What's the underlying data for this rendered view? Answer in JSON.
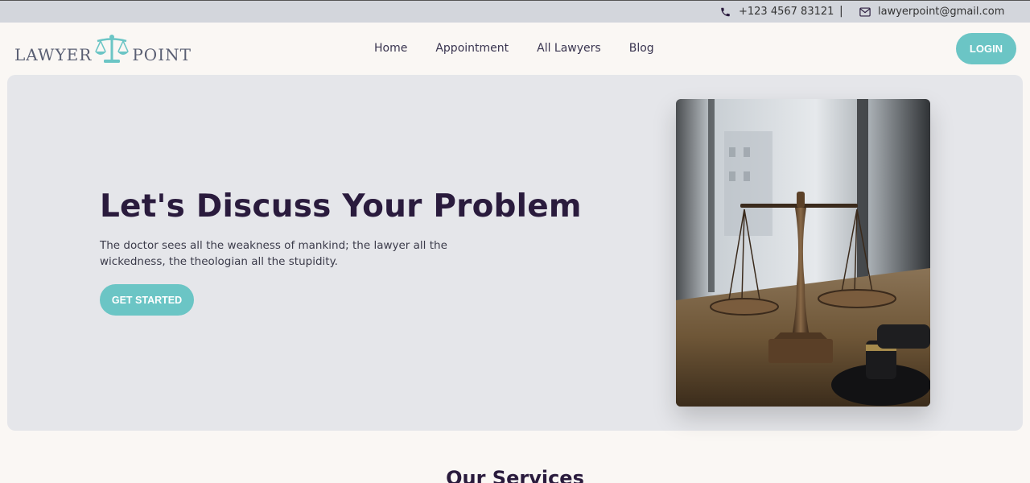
{
  "topbar": {
    "phone": "+123 4567 83121",
    "separator": "|",
    "email": "lawyerpoint@gmail.com",
    "phone_icon": "phone-icon",
    "email_icon": "envelope-icon"
  },
  "header": {
    "logo_left": "LAWYER",
    "logo_right": "POINT",
    "logo_icon": "scales-of-justice-icon",
    "menu": [
      "Home",
      "Appointment",
      "All Lawyers",
      "Blog"
    ],
    "login_label": "LOGIN"
  },
  "hero": {
    "title": "Let's Discuss Your Problem",
    "description": "The doctor sees all the weakness of mankind; the lawyer all the wickedness, the theologian all the stupidity.",
    "cta_label": "GET STARTED"
  },
  "services": {
    "heading": "Our Services"
  },
  "colors": {
    "accent": "#6bc5c5",
    "heading": "#2a1b3d",
    "topbar": "#d3d6dc",
    "hero_bg": "#e5e6ea",
    "page_bg": "#faf7f4"
  }
}
